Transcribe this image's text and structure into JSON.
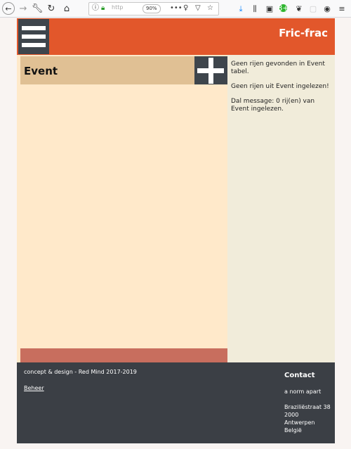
{
  "browser": {
    "url_text": "http",
    "zoom": "90%",
    "icons": {
      "back": "back-arrow-icon",
      "forward": "forward-arrow-icon",
      "tools": "wrench-icon",
      "reload": "reload-icon",
      "home": "home-icon",
      "info": "info-icon",
      "lock": "lock-icon",
      "more": "more-icon",
      "lightbulb": "lightbulb-icon",
      "pocket": "pocket-icon",
      "bookmark": "star-icon",
      "download": "download-icon",
      "library": "library-icon",
      "sidebar": "sidebar-icon",
      "extension": "extension-badge-icon",
      "account": "account-icon"
    },
    "extension_badge": "8+"
  },
  "header": {
    "site_title": "Fric-frac",
    "color": "#e2572b"
  },
  "main": {
    "section_title": "Event"
  },
  "aside": {
    "messages": [
      "Geen rijen gevonden in Event tabel.",
      "Geen rijen uit Event ingelezen!",
      "Dal message: 0 rij(en) van Event ingelezen."
    ]
  },
  "footer": {
    "credit": "concept & design - Red Mind 2017-2019",
    "admin_link": "Beheer",
    "contact": {
      "title": "Contact",
      "company": "a norm apart",
      "street": "Braziliëstraat 38",
      "postcode": "2000",
      "city": "Antwerpen",
      "country": "België"
    }
  }
}
